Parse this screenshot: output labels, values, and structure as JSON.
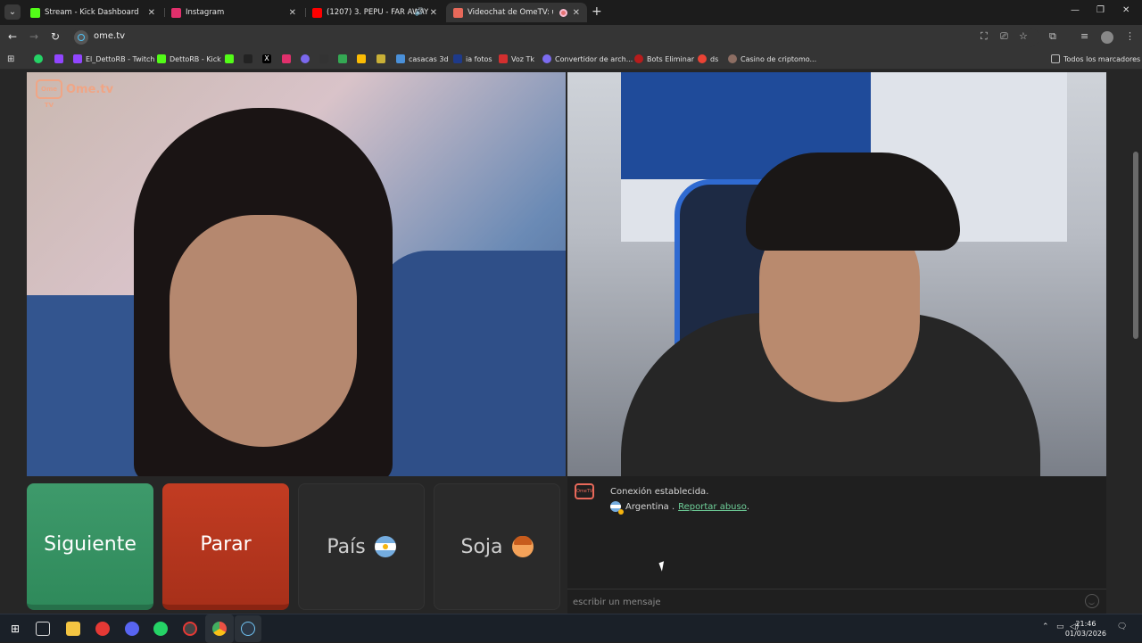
{
  "browser": {
    "tabs": [
      {
        "title": "Stream - Kick Dashboard",
        "favicon_color": "#53fc18"
      },
      {
        "title": "Instagram",
        "favicon_color": "#e1306c"
      },
      {
        "title": "(1207) 3. PEPU - FAR AWAY",
        "favicon_color": "#ff0000"
      },
      {
        "title": "Videochat de OmeTV: uno a",
        "favicon_color": "#e8695a"
      }
    ],
    "new_tab_label": "+",
    "url": "ome.tv",
    "bookmarks": [
      {
        "label": "",
        "color": "#25d366"
      },
      {
        "label": "",
        "color": "#9146ff"
      },
      {
        "label": "El_DettoRB - Twitch",
        "color": "#9146ff"
      },
      {
        "label": "DettoRB - Kick",
        "color": "#53fc18"
      },
      {
        "label": "",
        "color": "#53fc18"
      },
      {
        "label": "",
        "color": "#222222"
      },
      {
        "label": "",
        "color": "#000000"
      },
      {
        "label": "",
        "color": "#e1306c"
      },
      {
        "label": "",
        "color": "#7b68ee"
      },
      {
        "label": "",
        "color": "#333333"
      },
      {
        "label": "",
        "color": "#34a853"
      },
      {
        "label": "",
        "color": "#fbbc04"
      },
      {
        "label": "casacas 3d",
        "color": "#4a90d9"
      },
      {
        "label": "ia fotos",
        "color": "#1e3a8a"
      },
      {
        "label": "Voz Tk",
        "color": "#d32f2f"
      },
      {
        "label": "Convertidor de arch...",
        "color": "#7c6cf0"
      },
      {
        "label": "Bots Eliminar",
        "color": "#b71c1c"
      },
      {
        "label": "ds",
        "color": "#ea4335"
      },
      {
        "label": "Casino de criptomo...",
        "color": "#8d6e63"
      }
    ],
    "all_bookmarks_label": "Todos los marcadores"
  },
  "ometv": {
    "logo_text": "Ome.tv",
    "logo_badge": "Ome TV",
    "buttons": {
      "next": "Siguiente",
      "stop": "Parar",
      "country": "País",
      "gender": "Soja"
    },
    "chat": {
      "status": "Conexión establecida.",
      "country": "Argentina .",
      "report": "Reportar abuso",
      "report_suffix": ".",
      "input_placeholder": "escribir un mensaje"
    }
  },
  "taskbar": {
    "time": "21:46",
    "date": "01/03/2026"
  }
}
